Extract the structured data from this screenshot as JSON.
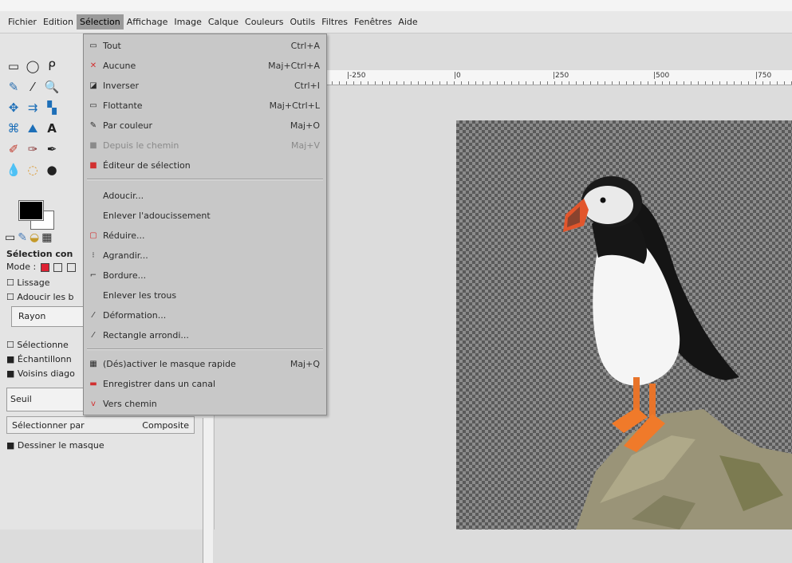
{
  "menubar": {
    "items": [
      {
        "label": "Fichier"
      },
      {
        "label": "Edition"
      },
      {
        "label": "Sélection"
      },
      {
        "label": "Affichage"
      },
      {
        "label": "Image"
      },
      {
        "label": "Calque"
      },
      {
        "label": "Couleurs"
      },
      {
        "label": "Outils"
      },
      {
        "label": "Filtres"
      },
      {
        "label": "Fenêtres"
      },
      {
        "label": "Aide"
      }
    ]
  },
  "selection_menu": {
    "items": [
      {
        "label": "Tout",
        "shortcut": "Ctrl+A",
        "icon": "select-all-icon"
      },
      {
        "label": "Aucune",
        "shortcut": "Maj+Ctrl+A",
        "icon": "select-none-icon"
      },
      {
        "label": "Inverser",
        "shortcut": "Ctrl+I",
        "icon": "invert-icon"
      },
      {
        "label": "Flottante",
        "shortcut": "Maj+Ctrl+L",
        "icon": "float-icon"
      },
      {
        "label": "Par couleur",
        "shortcut": "Maj+O",
        "icon": "by-color-icon"
      },
      {
        "label": "Depuis le chemin",
        "shortcut": "Maj+V",
        "icon": "from-path-icon",
        "disabled": true
      },
      {
        "label": "Éditeur de sélection",
        "shortcut": "",
        "icon": "selection-editor-icon"
      },
      {
        "label": "Adoucir...",
        "shortcut": "",
        "icon": ""
      },
      {
        "label": "Enlever l'adoucissement",
        "shortcut": "",
        "icon": ""
      },
      {
        "label": "Réduire...",
        "shortcut": "",
        "icon": "shrink-icon"
      },
      {
        "label": "Agrandir...",
        "shortcut": "",
        "icon": "grow-icon"
      },
      {
        "label": "Bordure...",
        "shortcut": "",
        "icon": "border-icon"
      },
      {
        "label": "Enlever les trous",
        "shortcut": "",
        "icon": ""
      },
      {
        "label": "Déformation...",
        "shortcut": "",
        "icon": "distort-icon"
      },
      {
        "label": "Rectangle arrondi...",
        "shortcut": "",
        "icon": "rounded-rect-icon"
      },
      {
        "label": "(Dés)activer le masque rapide",
        "shortcut": "Maj+Q",
        "icon": "quick-mask-icon"
      },
      {
        "label": "Enregistrer dans un canal",
        "shortcut": "",
        "icon": "save-channel-icon"
      },
      {
        "label": "Vers chemin",
        "shortcut": "",
        "icon": "to-path-icon"
      }
    ]
  },
  "ruler": {
    "labels": [
      "|-250",
      "|0",
      "|250",
      "|500",
      "|750"
    ]
  },
  "tool_options": {
    "title": "Sélection con",
    "mode_label": "Mode :",
    "lissage": "Lissage",
    "adoucir": "Adoucir les b",
    "rayon": "Rayon",
    "selectionne": "Sélectionne",
    "echantillon": "Échantillonn",
    "voisins": "Voisins diago",
    "seuil": "Seuil",
    "select_by_label": "Sélectionner par",
    "select_by_value": "Composite",
    "draw_mask": "Dessiner le masque"
  },
  "colors": {
    "menu_bg": "#c8c8c8",
    "menubar_bg": "#e8e8e8",
    "accent_red": "#d23030"
  }
}
